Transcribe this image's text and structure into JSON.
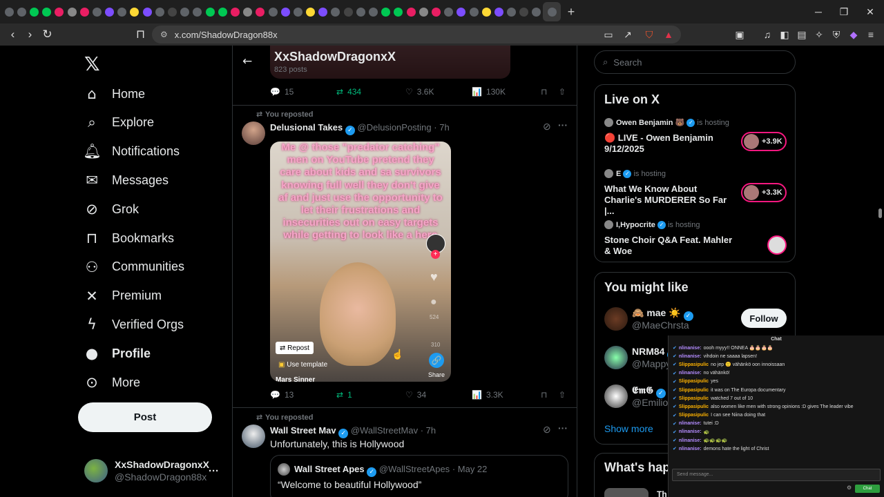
{
  "browser": {
    "url": "x.com/ShadowDragon88x",
    "tab_icon_count": 44,
    "controls": {
      "minimize": "─",
      "maximize": "❐",
      "close": "✕",
      "new_tab": "+"
    }
  },
  "nav": {
    "items": [
      {
        "label": "Home",
        "icon": "home-icon"
      },
      {
        "label": "Explore",
        "icon": "search-icon"
      },
      {
        "label": "Notifications",
        "icon": "bell-icon"
      },
      {
        "label": "Messages",
        "icon": "envelope-icon"
      },
      {
        "label": "Grok",
        "icon": "grok-icon"
      },
      {
        "label": "Bookmarks",
        "icon": "bookmark-icon"
      },
      {
        "label": "Communities",
        "icon": "people-icon"
      },
      {
        "label": "Premium",
        "icon": "x-icon"
      },
      {
        "label": "Verified Orgs",
        "icon": "bolt-icon"
      },
      {
        "label": "Profile",
        "icon": "person-icon"
      },
      {
        "label": "More",
        "icon": "more-circle-icon"
      }
    ],
    "post_label": "Post",
    "account": {
      "name": "XxShadowDragonxX",
      "handle": "@ShadowDragon88x",
      "more": "···"
    }
  },
  "profile": {
    "name": "XxShadowDragonxX",
    "posts": "823 posts"
  },
  "prev_post": {
    "replies": "15",
    "reposts": "434",
    "likes": "3.6K",
    "views": "130K"
  },
  "tweets": [
    {
      "reposted": "You reposted",
      "author": "Delusional Takes",
      "handle": "@DelusionPosting",
      "time": "· 7h",
      "media_text": "Me @ those \"predator catching\" men on YouTube pretend they care about kids and sa survivors knowing full well they don't give af and just use the opportunity to let their frustrations and insecurities out on easy targets while getting to look like a hero",
      "media_repost": "Repost",
      "media_template": "Use template",
      "media_author": "Mars Sinner",
      "media_share": "Share",
      "media_stat1": "524",
      "media_stat2": "310",
      "replies": "13",
      "reposts": "1",
      "likes": "34",
      "views": "3.3K"
    },
    {
      "reposted": "You reposted",
      "author": "Wall Street Mav",
      "handle": "@WallStreetMav",
      "time": "· 7h",
      "text": "Unfortunately, this is Hollywood",
      "quote": {
        "author": "Wall Street Apes",
        "handle": "@WallStreetApes",
        "time": "· May 22",
        "text": "“Welcome to beautiful Hollywood”"
      }
    }
  ],
  "search": {
    "placeholder": "Search"
  },
  "live": {
    "title": "Live on X",
    "items": [
      {
        "host": "Owen Benjamin 🐻",
        "status": "is hosting",
        "title1": "🔴 LIVE - Owen Benjamin",
        "title2": "9/12/2025",
        "count": "+3.9K"
      },
      {
        "host": "E",
        "status": "is hosting",
        "title1": "What We Know About",
        "title2": "Charlie's MURDERER So Far |...",
        "count": "+3.3K"
      },
      {
        "host": "I,Hypocrite",
        "status": "is hosting",
        "title1": "Stone Choir Q&A Feat. Mahler & Woe",
        "title2": "",
        "count": ""
      }
    ]
  },
  "wtf": {
    "title": "You might like",
    "users": [
      {
        "name": "🙈 mae ☀️",
        "handle": "@MaeChrsta",
        "follow": "Follow"
      },
      {
        "name": "NRM84",
        "handle": "@Mappy"
      },
      {
        "name": "𝕰𝖒𝕲",
        "handle": "@Emilio2"
      }
    ],
    "show_more": "Show more"
  },
  "whats_happening": {
    "title": "What's hap",
    "item": "Th"
  },
  "chat": {
    "title": "Chat",
    "placeholder": "Send message...",
    "send": "Chat",
    "messages": [
      {
        "user": "nlinanise:",
        "text": "oooh myyy!! ONNEA 🎂🎂🎂🎂",
        "color": "#b48cff"
      },
      {
        "user": "nlinanise:",
        "text": "vihdoin ne saaaa lapsen!",
        "color": "#b48cff"
      },
      {
        "user": "Slippasipulic",
        "text": "no jep 🙂 vähänkö oon innoissaan",
        "color": "#ffb300"
      },
      {
        "user": "nlinanise:",
        "text": "no vähänkö!",
        "color": "#b48cff"
      },
      {
        "user": "Slippasipulic",
        "text": "yes",
        "color": "#ffb300"
      },
      {
        "user": "Slippasipulic",
        "text": "it was on The Europa documentary",
        "color": "#ffb300"
      },
      {
        "user": "Slippasipulic",
        "text": "watched 7 out of 10",
        "color": "#ffb300"
      },
      {
        "user": "Slippasipulic",
        "text": "also women like men with strong opinions :D gives The leader vibe",
        "color": "#ffb300"
      },
      {
        "user": "Slippasipulic",
        "text": "I can see Niina doing that",
        "color": "#ffb300"
      },
      {
        "user": "nlinanise:",
        "text": "tutei :D",
        "color": "#b48cff"
      },
      {
        "user": "nlinanise:",
        "text": "🐢",
        "color": "#b48cff"
      },
      {
        "user": "nlinanise:",
        "text": "🐢🐢🐢🐢",
        "color": "#b48cff"
      },
      {
        "user": "nlinanise:",
        "text": "demons hate the light of Christ",
        "color": "#b48cff"
      }
    ]
  },
  "colors": {
    "accent": "#1d9bf0",
    "repost_green": "#00ba7c",
    "live_red": "#f91880"
  }
}
